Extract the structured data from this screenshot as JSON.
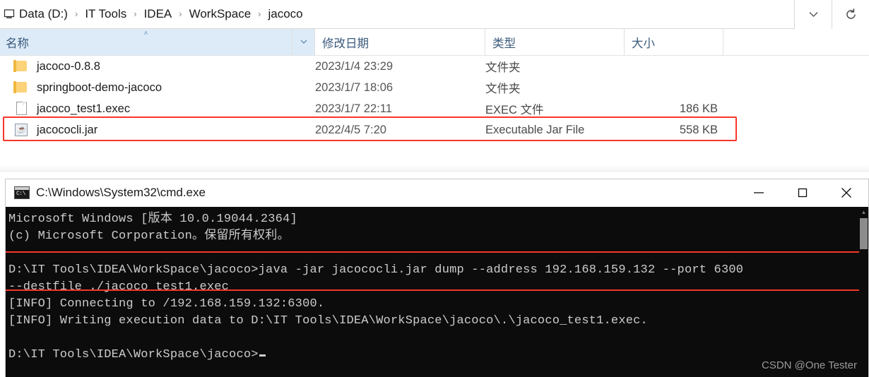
{
  "explorer": {
    "addressbar": {
      "root_icon": "this-pc-icon",
      "crumbs": [
        "Data (D:)",
        "IT Tools",
        "IDEA",
        "WorkSpace",
        "jacoco"
      ],
      "separator": "›",
      "dropdown_icon": "chevron-down-icon",
      "refresh_icon": "refresh-icon"
    },
    "columns": {
      "name": "名称",
      "date_modified": "修改日期",
      "type": "类型",
      "size": "大小",
      "sort_indicator": "˄",
      "name_dropdown_icon": "chevron-down-icon"
    },
    "rows": [
      {
        "icon": "folder-icon",
        "name": "jacoco-0.8.8",
        "date": "2023/1/4 23:29",
        "type": "文件夹",
        "size": ""
      },
      {
        "icon": "folder-icon",
        "name": "springboot-demo-jacoco",
        "date": "2023/1/7 18:06",
        "type": "文件夹",
        "size": ""
      },
      {
        "icon": "file-icon",
        "name": "jacoco_test1.exec",
        "date": "2023/1/7 22:11",
        "type": "EXEC 文件",
        "size": "186 KB"
      },
      {
        "icon": "jar-icon",
        "name": "jacococli.jar",
        "date": "2022/4/5 7:20",
        "type": "Executable Jar File",
        "size": "558 KB"
      }
    ],
    "annotation_highlight_color": "#f5362b"
  },
  "cmd": {
    "titlebar": {
      "icon": "cmd-icon",
      "title": "C:\\Windows\\System32\\cmd.exe",
      "minimize_label": "—",
      "maximize_label": "□",
      "close_label": "✕"
    },
    "console": {
      "lines": [
        "Microsoft Windows [版本 10.0.19044.2364]",
        "(c) Microsoft Corporation。保留所有权利。",
        "",
        "D:\\IT Tools\\IDEA\\WorkSpace\\jacoco>java -jar jacococli.jar dump --address 192.168.159.132 --port 6300",
        "--destfile ./jacoco_test1.exec",
        "[INFO] Connecting to /192.168.159.132:6300.",
        "[INFO] Writing execution data to D:\\IT Tools\\IDEA\\WorkSpace\\jacoco\\.\\jacoco_test1.exec.",
        ""
      ],
      "prompt": "D:\\IT Tools\\IDEA\\WorkSpace\\jacoco>",
      "cursor": "block-cursor",
      "scroll_up_icon": "▲",
      "background": "#0c0c0c",
      "foreground": "#cccccc"
    },
    "watermark": "CSDN @One Tester"
  }
}
